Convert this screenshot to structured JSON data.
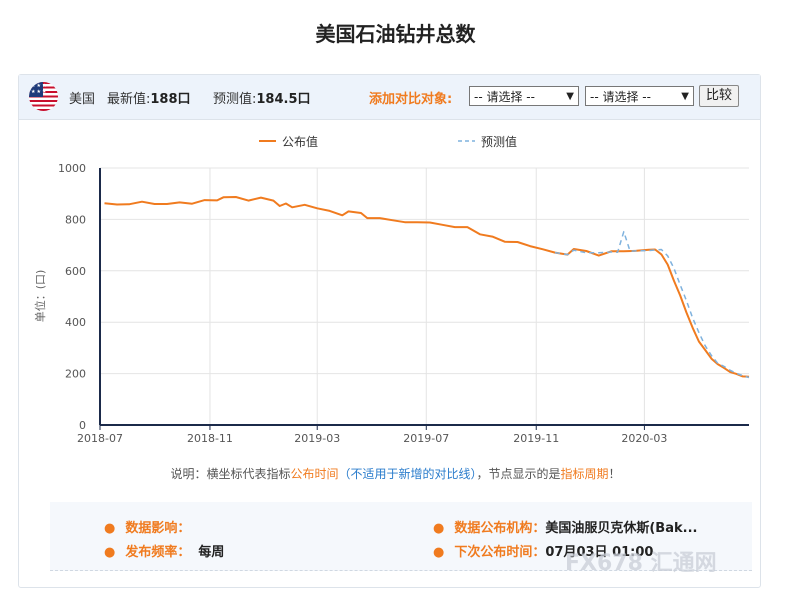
{
  "page": {
    "title": "美国石油钻井总数"
  },
  "toolbar": {
    "country": "美国",
    "latest_label": "最新值:",
    "latest_value": "188口",
    "forecast_label": "预测值:",
    "forecast_value": "184.5口",
    "compare_label": "添加对比对象:",
    "select1": "-- 请选择 --",
    "select2": "-- 请选择 --",
    "compare_button": "比较"
  },
  "note": {
    "p1": "说明：横坐标代表指标",
    "p2": "公布时间",
    "p3": "（不适用于新增的对比线）",
    "p4": "，节点显示的是",
    "p5": "指标周期",
    "p6": "！"
  },
  "info": {
    "impact_label": "数据影响：",
    "impact_value": "",
    "freq_label": "发布频率：",
    "freq_value": "每周",
    "org_label": "数据公布机构：",
    "org_value": "美国油服贝克休斯(Bak...",
    "next_label": "下次公布时间：",
    "next_value": "07月03日 01:00"
  },
  "watermark": "FX678 汇通网",
  "colors": {
    "actual": "#f07b1f",
    "forecast": "#7fb2de",
    "axis": "#1b2a4a",
    "grid": "#e4e4e4"
  },
  "chart_data": {
    "type": "line",
    "ylabel": "单位：(口)",
    "ylim": [
      0,
      1000
    ],
    "yticks": [
      0,
      200,
      400,
      600,
      800,
      1000
    ],
    "xlim": [
      "2018-07-01",
      "2020-06-26"
    ],
    "xticks": [
      {
        "date": "2018-07-01",
        "label": "2018-07"
      },
      {
        "date": "2018-11-01",
        "label": "2018-11"
      },
      {
        "date": "2019-03-01",
        "label": "2019-03"
      },
      {
        "date": "2019-07-01",
        "label": "2019-07"
      },
      {
        "date": "2019-11-01",
        "label": "2019-11"
      },
      {
        "date": "2020-03-01",
        "label": "2020-03"
      }
    ],
    "legend": [
      "公布值",
      "预测值"
    ],
    "series": [
      {
        "name": "公布值",
        "style": "solid",
        "points": [
          [
            "2018-07-06",
            863
          ],
          [
            "2018-07-20",
            858
          ],
          [
            "2018-08-03",
            859
          ],
          [
            "2018-08-17",
            869
          ],
          [
            "2018-08-31",
            860
          ],
          [
            "2018-09-14",
            860
          ],
          [
            "2018-09-28",
            866
          ],
          [
            "2018-10-12",
            861
          ],
          [
            "2018-10-26",
            875
          ],
          [
            "2018-11-09",
            874
          ],
          [
            "2018-11-16",
            886
          ],
          [
            "2018-11-30",
            887
          ],
          [
            "2018-12-14",
            873
          ],
          [
            "2018-12-28",
            885
          ],
          [
            "2019-01-11",
            873
          ],
          [
            "2019-01-18",
            852
          ],
          [
            "2019-01-25",
            862
          ],
          [
            "2019-02-01",
            847
          ],
          [
            "2019-02-15",
            857
          ],
          [
            "2019-03-01",
            843
          ],
          [
            "2019-03-15",
            833
          ],
          [
            "2019-03-29",
            816
          ],
          [
            "2019-04-05",
            831
          ],
          [
            "2019-04-19",
            825
          ],
          [
            "2019-04-26",
            805
          ],
          [
            "2019-05-10",
            805
          ],
          [
            "2019-05-24",
            797
          ],
          [
            "2019-06-07",
            789
          ],
          [
            "2019-06-21",
            789
          ],
          [
            "2019-07-05",
            788
          ],
          [
            "2019-07-19",
            779
          ],
          [
            "2019-08-02",
            770
          ],
          [
            "2019-08-16",
            770
          ],
          [
            "2019-08-30",
            742
          ],
          [
            "2019-09-13",
            733
          ],
          [
            "2019-09-27",
            713
          ],
          [
            "2019-10-11",
            712
          ],
          [
            "2019-10-25",
            696
          ],
          [
            "2019-11-08",
            684
          ],
          [
            "2019-11-22",
            671
          ],
          [
            "2019-12-06",
            663
          ],
          [
            "2019-12-13",
            685
          ],
          [
            "2019-12-27",
            677
          ],
          [
            "2020-01-10",
            659
          ],
          [
            "2020-01-24",
            676
          ],
          [
            "2020-02-07",
            676
          ],
          [
            "2020-02-21",
            678
          ],
          [
            "2020-03-06",
            682
          ],
          [
            "2020-03-13",
            683
          ],
          [
            "2020-03-20",
            664
          ],
          [
            "2020-03-27",
            624
          ],
          [
            "2020-04-03",
            562
          ],
          [
            "2020-04-10",
            504
          ],
          [
            "2020-04-17",
            438
          ],
          [
            "2020-04-24",
            378
          ],
          [
            "2020-05-01",
            325
          ],
          [
            "2020-05-08",
            292
          ],
          [
            "2020-05-15",
            258
          ],
          [
            "2020-05-22",
            237
          ],
          [
            "2020-05-29",
            222
          ],
          [
            "2020-06-05",
            206
          ],
          [
            "2020-06-12",
            199
          ],
          [
            "2020-06-19",
            189
          ],
          [
            "2020-06-26",
            188
          ]
        ]
      },
      {
        "name": "预测值",
        "style": "dashed",
        "points": [
          [
            "2019-11-22",
            671
          ],
          [
            "2019-12-06",
            663
          ],
          [
            "2019-12-13",
            680
          ],
          [
            "2019-12-27",
            670
          ],
          [
            "2020-01-10",
            670
          ],
          [
            "2020-01-24",
            673
          ],
          [
            "2020-01-31",
            672
          ],
          [
            "2020-02-07",
            752
          ],
          [
            "2020-02-14",
            676
          ],
          [
            "2020-02-21",
            678
          ],
          [
            "2020-03-06",
            679
          ],
          [
            "2020-03-13",
            681
          ],
          [
            "2020-03-20",
            683
          ],
          [
            "2020-03-27",
            658
          ],
          [
            "2020-04-03",
            610
          ],
          [
            "2020-04-10",
            545
          ],
          [
            "2020-04-17",
            484
          ],
          [
            "2020-04-24",
            416
          ],
          [
            "2020-05-01",
            360
          ],
          [
            "2020-05-08",
            308
          ],
          [
            "2020-05-15",
            270
          ],
          [
            "2020-05-22",
            240
          ],
          [
            "2020-05-29",
            228
          ],
          [
            "2020-06-05",
            213
          ],
          [
            "2020-06-12",
            201
          ],
          [
            "2020-06-19",
            192
          ],
          [
            "2020-06-26",
            185
          ]
        ]
      }
    ]
  }
}
